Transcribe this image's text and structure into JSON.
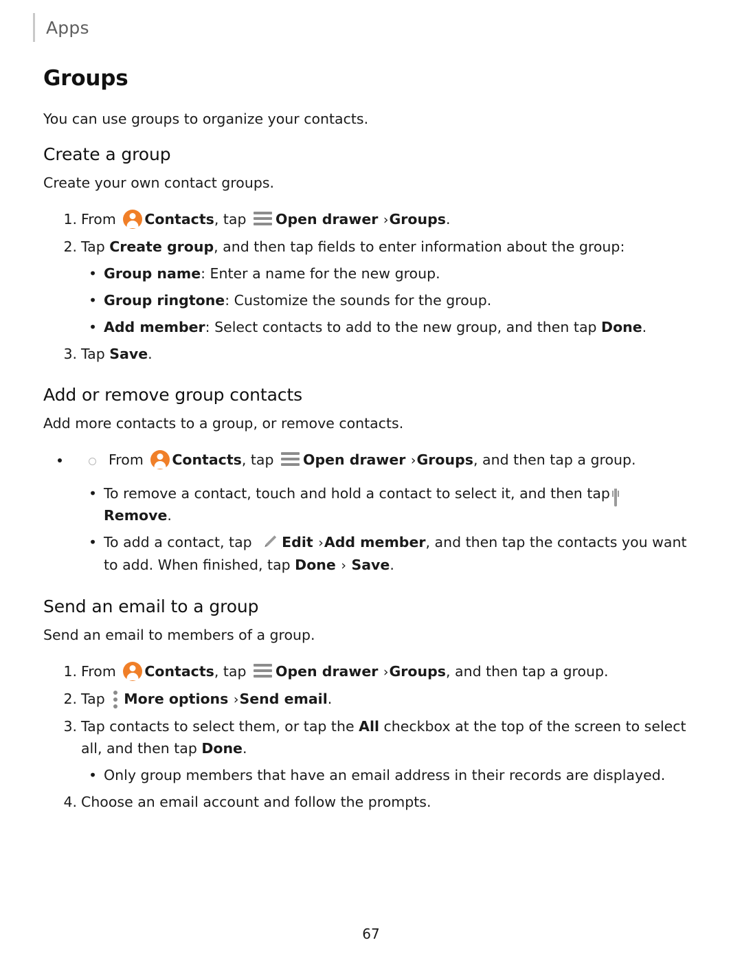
{
  "header": {
    "chapter": "Apps"
  },
  "page": {
    "title": "Groups",
    "intro": "You can use groups to organize your contacts.",
    "number": "67"
  },
  "sections": [
    {
      "heading": "Create a group",
      "intro": "Create your own contact groups.",
      "steps": {
        "s1_num": "1.",
        "s1_a": "From",
        "s1_b": "Contacts",
        "s1_c": ", tap",
        "s1_d": "Open drawer",
        "s1_chev": "›",
        "s1_e": "Groups",
        "s1_f": ".",
        "s2_num": "2.",
        "s2_a": "Tap",
        "s2_b": "Create group",
        "s2_c": ", and then tap fields to enter information about the group:",
        "b1_label": "Group name",
        "b1_text": ": Enter a name for the new group.",
        "b2_label": "Group ringtone",
        "b2_text": ": Customize the sounds for the group.",
        "b3_label": "Add member",
        "b3_text": ": Select contacts to add to the new group, and then tap ",
        "b3_bold": "Done",
        "b3_end": ".",
        "s3_num": "3.",
        "s3_a": "Tap",
        "s3_b": "Save",
        "s3_c": "."
      }
    },
    {
      "heading": "Add or remove group contacts",
      "intro": "Add more contacts to a group, or remove contacts.",
      "steps": {
        "h1_a": "From",
        "h1_b": "Contacts",
        "h1_c": ", tap",
        "h1_d": "Open drawer",
        "h1_chev": "›",
        "h1_e": "Groups",
        "h1_f": ", and then tap a group.",
        "b1_a": "To remove a contact, touch and hold a contact to select it, and then tap",
        "b1_b": "Remove",
        "b1_c": ".",
        "b2_a": "To add a contact, tap",
        "b2_b": "Edit",
        "b2_chev": "›",
        "b2_c": "Add member",
        "b2_d": ", and then tap the contacts you want to add. When finished, tap ",
        "b2_e": "Done",
        "b2_chev2": "›",
        "b2_f": "Save",
        "b2_g": "."
      }
    },
    {
      "heading": "Send an email to a group",
      "intro": "Send an email to members of a group.",
      "steps": {
        "s1_num": "1.",
        "s1_a": "From",
        "s1_b": "Contacts",
        "s1_c": ", tap",
        "s1_d": "Open drawer",
        "s1_chev": "›",
        "s1_e": "Groups",
        "s1_f": ", and then tap a group.",
        "s2_num": "2.",
        "s2_a": "Tap",
        "s2_b": "More options",
        "s2_chev": "›",
        "s2_c": "Send email",
        "s2_d": ".",
        "s3_num": "3.",
        "s3_a": "Tap contacts to select them, or tap the ",
        "s3_b": "All",
        "s3_c": " checkbox at the top of the screen to select all, and then tap ",
        "s3_d": "Done",
        "s3_e": ".",
        "b1_text": "Only group members that have an email address in their records are displayed.",
        "s4_num": "4.",
        "s4_a": "Choose an email account and follow the prompts."
      }
    }
  ],
  "icons": {
    "contacts": "contacts-icon",
    "drawer": "open-drawer-icon",
    "trash": "remove-trash-icon",
    "pencil": "edit-pencil-icon",
    "more": "more-options-icon"
  },
  "colors": {
    "accent": "#f07f28",
    "icon_gray": "#8c8c8c",
    "header_gray": "#5f5f5f"
  }
}
